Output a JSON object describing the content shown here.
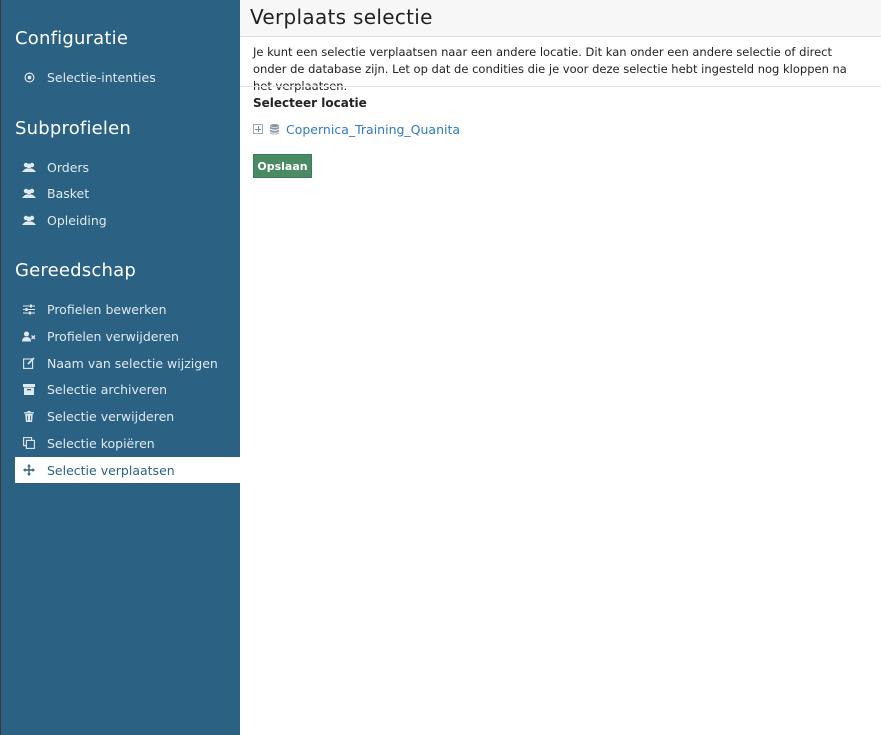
{
  "sidebar": {
    "sections": [
      {
        "title": "Configuratie",
        "items": [
          {
            "label": "Selectie-intenties",
            "icon": "target-icon"
          }
        ]
      },
      {
        "title": "Subprofielen",
        "items": [
          {
            "label": "Orders",
            "icon": "users-icon"
          },
          {
            "label": "Basket",
            "icon": "users-icon"
          },
          {
            "label": "Opleiding",
            "icon": "users-icon"
          }
        ]
      },
      {
        "title": "Gereedschap",
        "items": [
          {
            "label": "Profielen bewerken",
            "icon": "sliders-icon"
          },
          {
            "label": "Profielen verwijderen",
            "icon": "user-remove-icon"
          },
          {
            "label": "Naam van selectie wijzigen",
            "icon": "edit-icon"
          },
          {
            "label": "Selectie archiveren",
            "icon": "archive-icon"
          },
          {
            "label": "Selectie verwijderen",
            "icon": "trash-icon"
          },
          {
            "label": "Selectie kopiëren",
            "icon": "copy-icon"
          },
          {
            "label": "Selectie verplaatsen",
            "icon": "move-icon",
            "active": true
          }
        ]
      }
    ]
  },
  "main": {
    "title": "Verplaats selectie",
    "description": "Je kunt een selectie verplaatsen naar een andere locatie. Dit kan onder een andere selectie of direct onder de database zijn. Let op dat de condities die je voor deze selectie hebt ingesteld nog kloppen na het verplaatsen.",
    "location_label": "Selecteer locatie",
    "tree": [
      {
        "label": "Copernica_Training_Quanita",
        "icon": "database-icon"
      }
    ],
    "save_label": "Opslaan"
  },
  "colors": {
    "sidebar_bg": "#2b6283",
    "link": "#2f7bbf",
    "save_button": "#4a8a64"
  }
}
